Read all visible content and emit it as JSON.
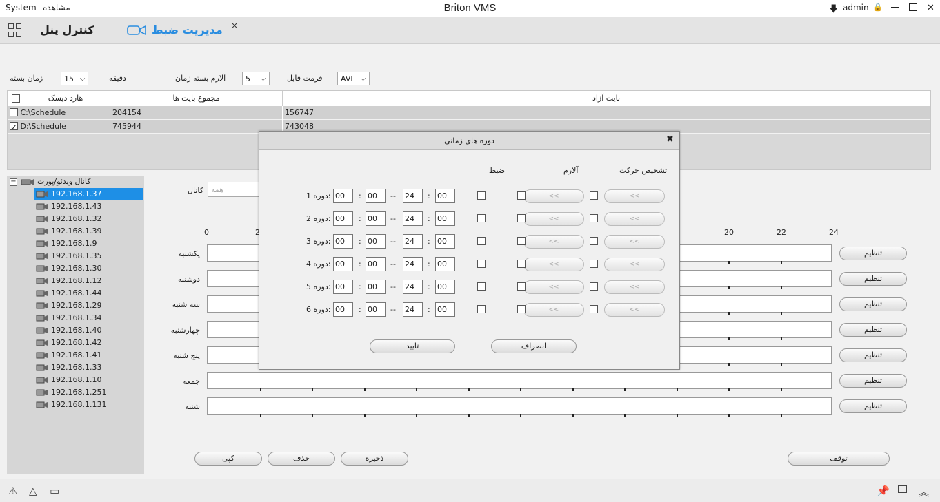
{
  "titlebar": {
    "menu_system": "System",
    "menu_view": "مشاهده",
    "title": "Briton VMS",
    "user": "admin"
  },
  "tabs": {
    "control_panel": "کنترل پنل",
    "record_management": "مدیریت ضبط",
    "close": "×"
  },
  "settings": {
    "file_format_label": "فرمت فایل",
    "file_format_value": "AVI",
    "alarm_duration_label": "آلارم بسته زمان",
    "alarm_duration_value": "5",
    "minute_label": "دقیقه",
    "pack_time_label": "زمان بسته",
    "pack_time_value": "15"
  },
  "disk_table": {
    "headers": {
      "disk": "هارد دیسک",
      "total": "مجموع بایت ها",
      "free": "بایت آزاد"
    },
    "rows": [
      {
        "disk": "C:\\Schedule",
        "total": "204154",
        "free": "156747",
        "checked": false
      },
      {
        "disk": "D:\\Schedule",
        "total": "745944",
        "free": "743048",
        "checked": true
      }
    ]
  },
  "tree": {
    "root": "کانال ویدئو/پورت",
    "collapse": "−",
    "items": [
      "192.168.1.37",
      "192.168.1.43",
      "192.168.1.32",
      "192.168.1.39",
      "192.168.1.9",
      "192.168.1.35",
      "192.168.1.30",
      "192.168.1.12",
      "192.168.1.44",
      "192.168.1.29",
      "192.168.1.34",
      "192.168.1.40",
      "192.168.1.42",
      "192.168.1.41",
      "192.168.1.33",
      "192.168.1.10",
      "192.168.1.251",
      "192.168.1.131"
    ],
    "selected_index": 0
  },
  "schedule": {
    "channel_label": "کانال",
    "channel_placeholder": "همه",
    "hours": [
      "0",
      "2",
      "20",
      "22",
      "24"
    ],
    "days": [
      "یکشنبه",
      "دوشنبه",
      "سه شنبه",
      "چهارشنبه",
      "پنج شنبه",
      "جمعه",
      "شنبه"
    ],
    "set_label": "تنظیم",
    "copy": "کپی",
    "delete": "حذف",
    "save": "ذخیره",
    "stop": "توقف"
  },
  "dialog": {
    "title": "دوره های زمانی",
    "close": "✖",
    "col_motion": "تشخیص حرکت",
    "col_alarm": "آلارم",
    "col_record": "ضبط",
    "periods": [
      {
        "label": "دوره 1:",
        "h1": "00",
        "m1": "00",
        "h2": "24",
        "m2": "00"
      },
      {
        "label": "دوره 2:",
        "h1": "00",
        "m1": "00",
        "h2": "24",
        "m2": "00"
      },
      {
        "label": "دوره 3:",
        "h1": "00",
        "m1": "00",
        "h2": "24",
        "m2": "00"
      },
      {
        "label": "دوره 4:",
        "h1": "00",
        "m1": "00",
        "h2": "24",
        "m2": "00"
      },
      {
        "label": "دوره 5:",
        "h1": "00",
        "m1": "00",
        "h2": "24",
        "m2": "00"
      },
      {
        "label": "دوره 6:",
        "h1": "00",
        "m1": "00",
        "h2": "24",
        "m2": "00"
      }
    ],
    "colon": ":",
    "dash": "--",
    "expand": "<<",
    "confirm": "تایید",
    "cancel": "انصراف"
  },
  "colors": {
    "accent": "#2a8de0",
    "selection": "#1e8fe6"
  }
}
